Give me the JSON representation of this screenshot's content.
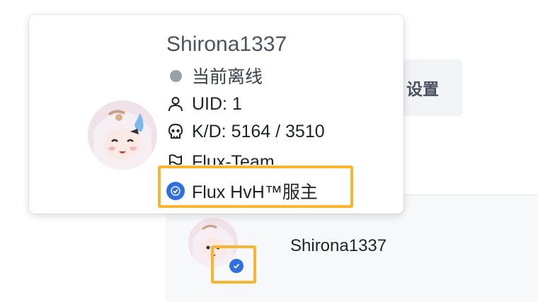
{
  "background": {
    "settings_label": "设置",
    "row": {
      "name": "Shirona1337"
    }
  },
  "popover": {
    "name": "Shirona1337",
    "status": "当前离线",
    "uid": "UID: 1",
    "kd": "K/D: 5164 / 3510",
    "team": "Flux-Team",
    "badge": "Flux HvH™服主"
  },
  "colors": {
    "highlight": "#f7b531",
    "badge_blue": "#2f6fe0",
    "offline_dot": "#9aa0a9"
  },
  "icons": {
    "status": "offline-dot-icon",
    "uid": "user-icon",
    "kd": "skull-icon",
    "team": "flag-icon",
    "badge": "verified-badge-icon"
  }
}
